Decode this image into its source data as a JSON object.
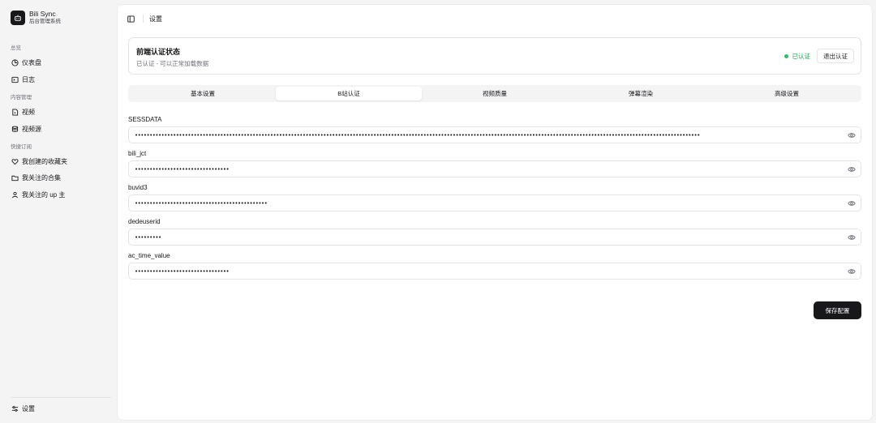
{
  "app": {
    "title": "Bili Sync",
    "subtitle": "后台管理系统"
  },
  "sidebar": {
    "groups": [
      {
        "label": "总览",
        "items": [
          {
            "label": "仪表盘",
            "icon": "gauge-icon"
          },
          {
            "label": "日志",
            "icon": "terminal-icon"
          }
        ]
      },
      {
        "label": "内容管理",
        "items": [
          {
            "label": "视频",
            "icon": "file-video-icon"
          },
          {
            "label": "视频源",
            "icon": "database-icon"
          }
        ]
      },
      {
        "label": "快捷订阅",
        "items": [
          {
            "label": "我创建的收藏夹",
            "icon": "heart-icon"
          },
          {
            "label": "我关注的合集",
            "icon": "folder-icon"
          },
          {
            "label": "我关注的 up 主",
            "icon": "user-icon"
          }
        ]
      }
    ],
    "footer": {
      "label": "设置",
      "icon": "settings-sliders-icon"
    }
  },
  "header": {
    "breadcrumb": "设置"
  },
  "auth": {
    "title": "前端认证状态",
    "subtitle": "已认证 - 可以正常加载数据",
    "status": "已认证",
    "status_color": "#22c55e",
    "logout_label": "退出认证"
  },
  "tabs": [
    {
      "label": "基本设置",
      "active": false
    },
    {
      "label": "B站认证",
      "active": true
    },
    {
      "label": "视频质量",
      "active": false
    },
    {
      "label": "弹幕渲染",
      "active": false
    },
    {
      "label": "高级设置",
      "active": false
    }
  ],
  "fields": [
    {
      "label": "SESSDATA",
      "value": "••••••••••••••••••••••••••••••••••••••••••••••••••••••••••••••••••••••••••••••••••••••••••••••••••••••••••••••••••••••••••••••••••••••••••••••••••••••••••••••••••••••••••••••••••••••••••••••••"
    },
    {
      "label": "bili_jct",
      "value": "••••••••••••••••••••••••••••••••"
    },
    {
      "label": "buvid3",
      "value": "•••••••••••••••••••••••••••••••••••••••••••••"
    },
    {
      "label": "dedeuserid",
      "value": "•••••••••"
    },
    {
      "label": "ac_time_value",
      "value": "••••••••••••••••••••••••••••••••"
    }
  ],
  "save_label": "保存配置",
  "accent_color": "#18181b"
}
